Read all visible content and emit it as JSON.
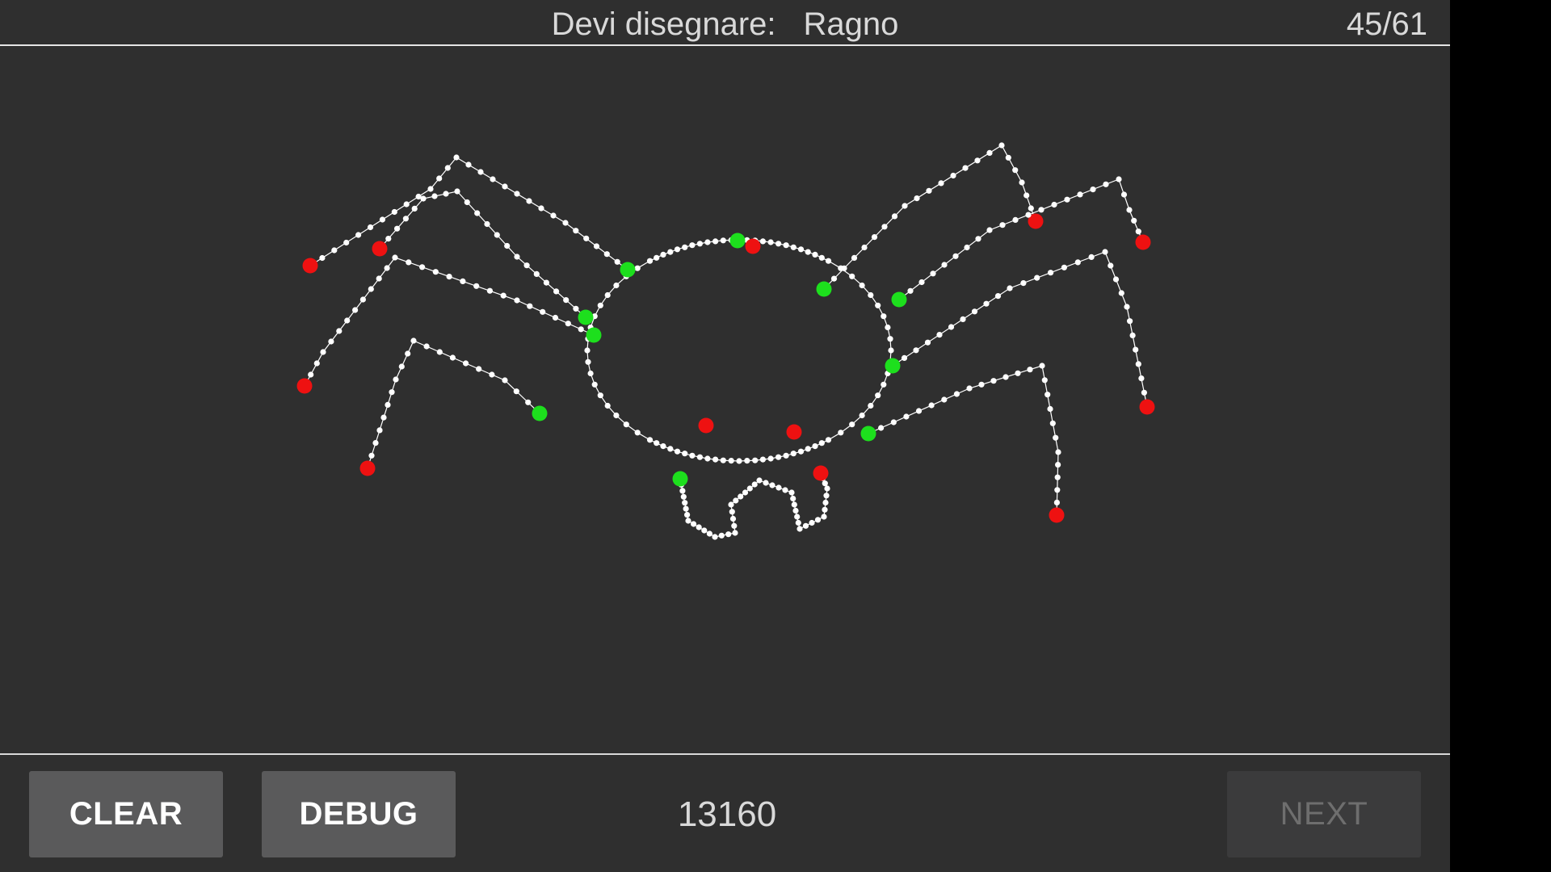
{
  "header": {
    "prompt_label": "Devi disegnare:",
    "target_word": "Ragno",
    "progress": "45/61"
  },
  "toolbar": {
    "clear_label": "CLEAR",
    "debug_label": "DEBUG",
    "score": "13160",
    "next_label": "NEXT",
    "next_enabled": false
  },
  "colors": {
    "background": "#2f2f2f",
    "stroke": "#ffffff",
    "stroke_start": "#1ddf1d",
    "stroke_end": "#ee1111"
  }
}
